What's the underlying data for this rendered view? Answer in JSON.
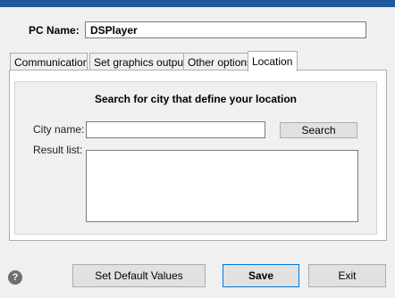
{
  "header": {
    "pc_name_label": "PC Name:",
    "pc_name_value": "DSPlayer"
  },
  "tabs": [
    {
      "label": "Communications",
      "active": false
    },
    {
      "label": "Set graphics output",
      "active": false
    },
    {
      "label": "Other options",
      "active": false
    },
    {
      "label": "Location",
      "active": true
    }
  ],
  "location": {
    "title": "Search for city that define your location",
    "city_label": "City name:",
    "city_value": "",
    "search_button": "Search",
    "result_label": "Result list:",
    "results": []
  },
  "footer": {
    "help_icon": "question-icon",
    "help_glyph": "?",
    "default_button": "Set Default Values",
    "save_button": "Save",
    "exit_button": "Exit"
  },
  "colors": {
    "title_bar": "#1f5aa0",
    "background": "#f0f0f0",
    "button_face": "#e1e1e1",
    "focus_border": "#0078d7"
  }
}
